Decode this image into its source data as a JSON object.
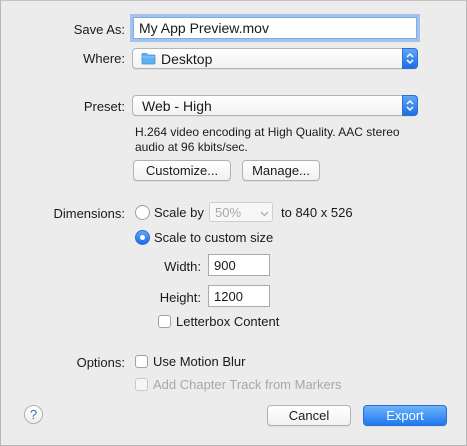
{
  "save_as": {
    "label": "Save As:",
    "value": "My App Preview.mov"
  },
  "where": {
    "label": "Where:",
    "value": "Desktop",
    "icon": "folder-icon"
  },
  "preset": {
    "label": "Preset:",
    "value": "Web - High",
    "description_line1": "H.264 video encoding at High Quality.  AAC stereo",
    "description_line2": "audio at 96 kbits/sec."
  },
  "buttons": {
    "customize": "Customize...",
    "manage": "Manage...",
    "cancel": "Cancel",
    "export": "Export",
    "help": "?"
  },
  "dimensions": {
    "label": "Dimensions:",
    "scale_by_label": "Scale by",
    "scale_by_value": "50%",
    "scale_result": "to 840 x 526",
    "custom_label": "Scale to custom size",
    "selected": "custom",
    "width_label": "Width:",
    "width_value": "900",
    "height_label": "Height:",
    "height_value": "1200",
    "letterbox_label": "Letterbox Content",
    "letterbox_checked": false
  },
  "options": {
    "label": "Options:",
    "motion_blur_label": "Use Motion Blur",
    "motion_blur_checked": false,
    "chapter_track_label": "Add Chapter Track from Markers",
    "chapter_track_checked": false,
    "chapter_track_enabled": false
  },
  "colors": {
    "accent": "#1f78f0",
    "background": "#ececec",
    "disabled_text": "#a8a8a8"
  }
}
